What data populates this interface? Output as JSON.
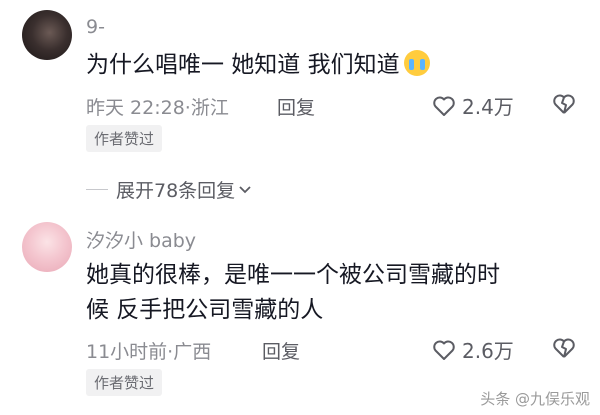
{
  "comments": [
    {
      "username": "9-",
      "text": "为什么唱唯一 她知道 我们知道",
      "emoji": "crying-face",
      "meta": "昨天 22:28·浙江",
      "reply_label": "回复",
      "likes": "2.4万",
      "badge": "作者赞过"
    },
    {
      "username": "汐汐小 baby",
      "text_line1": "她真的很棒，是唯一一个被公司雪藏的时",
      "text_line2": "候 反手把公司雪藏的人",
      "meta": "11小时前·广西",
      "reply_label": "回复",
      "likes": "2.6万",
      "badge": "作者赞过"
    }
  ],
  "expand": {
    "label": "展开78条回复"
  },
  "watermark": "头条 @九俣乐观"
}
